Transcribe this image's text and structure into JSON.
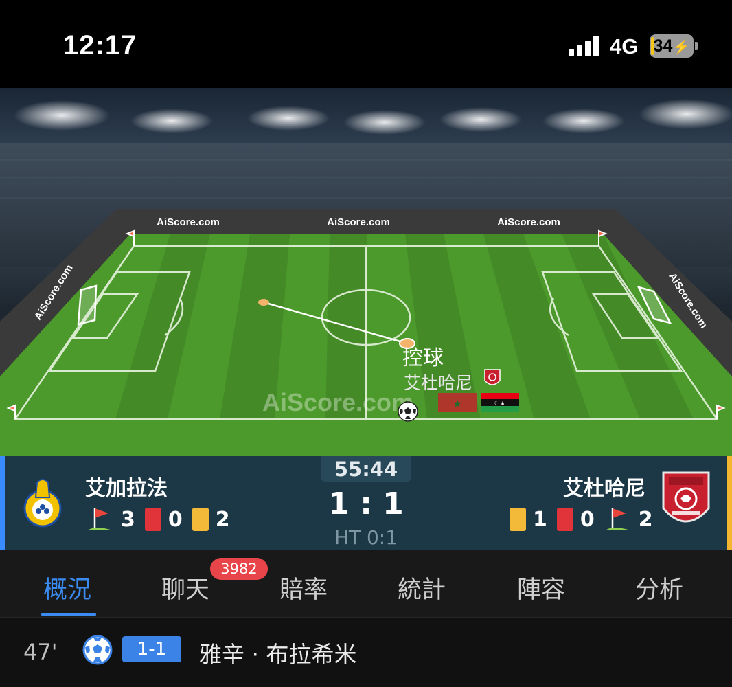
{
  "status_bar": {
    "time": "12:17",
    "network": "4G",
    "battery": "34"
  },
  "pitch": {
    "sponsor_boards": [
      "AiScore.com",
      "AiScore.com",
      "AiScore.com",
      "AiScore.com",
      "AiScore.com"
    ],
    "watermark": "AiScore.com",
    "possession_label": "控球",
    "possession_team": "艾杜哈尼"
  },
  "match": {
    "clock": "55:44",
    "score": "1 : 1",
    "halftime": "HT 0:1",
    "home": {
      "name": "艾加拉法",
      "corners": "3",
      "red_cards": "0",
      "yellow_cards": "2"
    },
    "away": {
      "name": "艾杜哈尼",
      "yellow_cards": "1",
      "red_cards": "0",
      "corners": "2"
    },
    "colors": {
      "home_accent": "#3a8bff",
      "away_accent": "#f4b530"
    }
  },
  "tabs": [
    {
      "label": "概況",
      "active": true
    },
    {
      "label": "聊天",
      "badge": "3982"
    },
    {
      "label": "賠率"
    },
    {
      "label": "統計"
    },
    {
      "label": "陣容"
    },
    {
      "label": "分析"
    }
  ],
  "events": [
    {
      "minute": "47'",
      "icon": "soccer-ball-icon",
      "score": "1-1",
      "player": "雅辛 · 布拉希米"
    }
  ]
}
